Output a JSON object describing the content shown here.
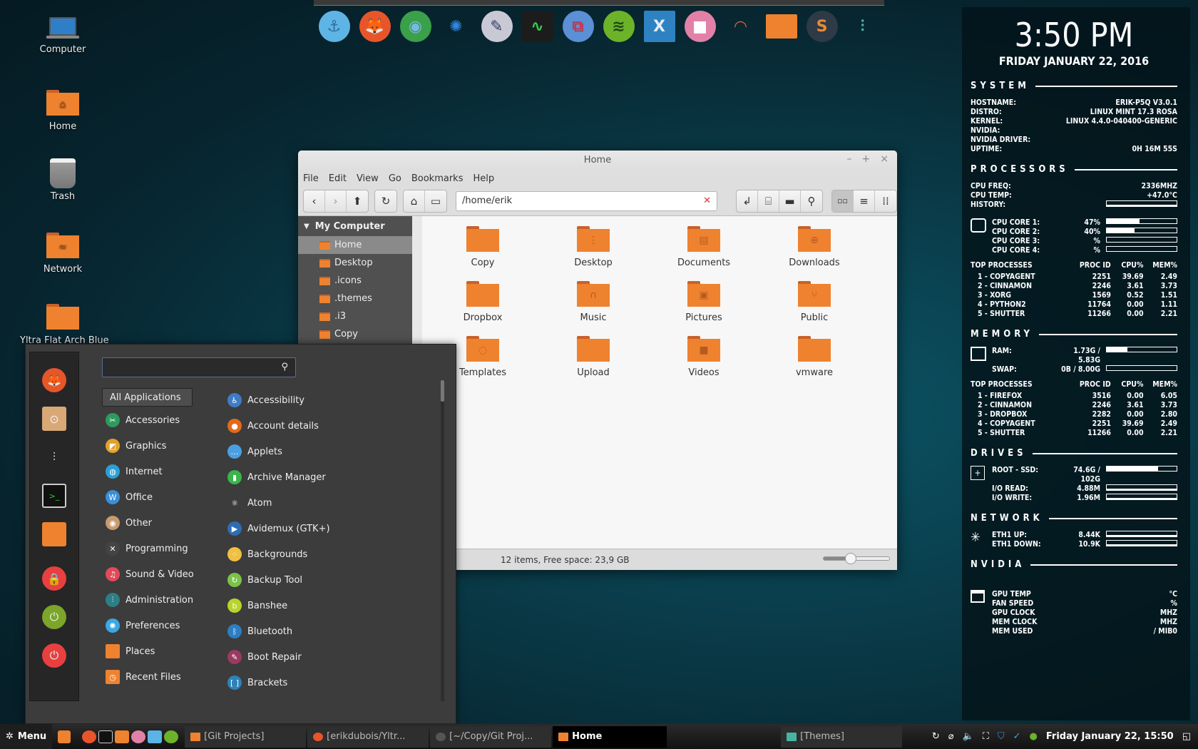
{
  "dock": {
    "items": [
      {
        "name": "anchor",
        "glyph": "⚓",
        "bg": "#5fb4e6",
        "fg": "#2a6e9a"
      },
      {
        "name": "firefox",
        "glyph": "🦊",
        "bg": "#e8552a",
        "fg": "#fff"
      },
      {
        "name": "chrome",
        "glyph": "◉",
        "bg": "#3aa04a",
        "fg": "#7ab8e4"
      },
      {
        "name": "aperture",
        "glyph": "✺",
        "bg": "transparent",
        "fg": "#2f86e0"
      },
      {
        "name": "inkscape",
        "glyph": "✎",
        "bg": "#c9c9d6",
        "fg": "#353a63"
      },
      {
        "name": "system-monitor",
        "glyph": "∿",
        "bg": "#1c1c1c",
        "fg": "#33d04a"
      },
      {
        "name": "remote-desktop",
        "glyph": "⧉",
        "bg": "#5b8fd6",
        "fg": "#c0354d"
      },
      {
        "name": "spotify",
        "glyph": "≋",
        "bg": "#6db32a",
        "fg": "#1e4a10"
      },
      {
        "name": "x-window",
        "glyph": "X",
        "bg": "#2f82c2",
        "fg": "#e6eef6"
      },
      {
        "name": "video-recorder",
        "glyph": "■",
        "bg": "#e281a8",
        "fg": "#fff"
      },
      {
        "name": "disk-usage",
        "glyph": "◠",
        "bg": "transparent",
        "fg": "#e25b3a"
      },
      {
        "name": "folder",
        "glyph": "",
        "bg": "#ef822f",
        "fg": "#ef822f"
      },
      {
        "name": "sublime",
        "glyph": "S",
        "bg": "#2e3a45",
        "fg": "#e98a35"
      },
      {
        "name": "settings-sliders",
        "glyph": "⫶",
        "bg": "transparent",
        "fg": "#46b4a2"
      }
    ]
  },
  "desktop": {
    "icons": [
      {
        "label": "Computer"
      },
      {
        "label": "Home",
        "glyph": "⌂"
      },
      {
        "label": "Trash"
      },
      {
        "label": "Network",
        "glyph": "≈"
      },
      {
        "label": "Yltra Flat Arch Blue"
      }
    ]
  },
  "conky": {
    "time": "3:50 PM",
    "date": "FRIDAY JANUARY 22, 2016",
    "system": {
      "title": "SYSTEM",
      "rows": [
        {
          "k": "HOSTNAME:",
          "v": "ERIK-P5Q  V3.0.1"
        },
        {
          "k": "DISTRO:",
          "v": "LINUX MINT 17.3 ROSA"
        },
        {
          "k": "KERNEL:",
          "v": "LINUX 4.4.0-040400-GENERIC"
        },
        {
          "k": "NVIDIA:",
          "v": ""
        },
        {
          "k": "NVIDIA DRIVER:",
          "v": ""
        },
        {
          "k": "UPTIME:",
          "v": "0H 16M 55S"
        }
      ]
    },
    "processors": {
      "title": "PROCESSORS",
      "freq_label": "CPU FREQ:",
      "freq": "2336MHZ",
      "temp_label": "CPU TEMP:",
      "temp": "+47.0°C",
      "history_label": "HISTORY:",
      "cores": [
        {
          "label": "CPU CORE 1:",
          "value": "47%",
          "pct": 47
        },
        {
          "label": "CPU CORE 2:",
          "value": "40%",
          "pct": 40
        },
        {
          "label": "CPU CORE 3:",
          "value": "%",
          "pct": 0
        },
        {
          "label": "CPU CORE 4:",
          "value": "%",
          "pct": 0
        }
      ],
      "top_header": [
        "TOP PROCESSES",
        "PROC ID",
        "CPU%",
        "MEM%"
      ],
      "top": [
        [
          "1 - COPYAGENT",
          "2251",
          "39.69",
          "2.49"
        ],
        [
          "2 - CINNAMON",
          "2246",
          "3.61",
          "3.73"
        ],
        [
          "3 - XORG",
          "1569",
          "0.52",
          "1.51"
        ],
        [
          "4 - PYTHON2",
          "11764",
          "0.00",
          "1.11"
        ],
        [
          "5 - SHUTTER",
          "11266",
          "0.00",
          "2.21"
        ]
      ]
    },
    "memory": {
      "title": "MEMORY",
      "ram_label": "RAM:",
      "ram": "1.73G / 5.83G",
      "ram_pct": 30,
      "swap_label": "SWAP:",
      "swap": "0B / 8.00G",
      "swap_pct": 0,
      "top_header": [
        "TOP PROCESSES",
        "PROC ID",
        "CPU%",
        "MEM%"
      ],
      "top": [
        [
          "1 - FIREFOX",
          "3516",
          "0.00",
          "6.05"
        ],
        [
          "2 - CINNAMON",
          "2246",
          "3.61",
          "3.73"
        ],
        [
          "3 - DROPBOX",
          "2282",
          "0.00",
          "2.80"
        ],
        [
          "4 - COPYAGENT",
          "2251",
          "39.69",
          "2.49"
        ],
        [
          "5 - SHUTTER",
          "11266",
          "0.00",
          "2.21"
        ]
      ]
    },
    "drives": {
      "title": "DRIVES",
      "root_label": "ROOT - SSD:",
      "root": "74.6G / 102G",
      "root_pct": 73,
      "read_label": "I/O READ:",
      "read": "4.88M",
      "write_label": "I/O WRITE:",
      "write": "1.96M"
    },
    "network": {
      "title": "NETWORK",
      "up_label": "ETH1 UP:",
      "up": "8.44K",
      "down_label": "ETH1 DOWN:",
      "down": "10.9K"
    },
    "nvidia": {
      "title": "NVIDIA",
      "rows": [
        {
          "k": "GPU TEMP",
          "v": "°C"
        },
        {
          "k": "FAN SPEED",
          "v": "%"
        },
        {
          "k": "GPU CLOCK",
          "v": "MHZ"
        },
        {
          "k": "MEM CLOCK",
          "v": "MHZ"
        },
        {
          "k": "MEM USED",
          "v": "/ MIB0"
        }
      ]
    }
  },
  "filemanager": {
    "title": "Home",
    "controls": {
      "minimize": "–",
      "maximize": "+",
      "close": "×"
    },
    "menu": [
      "File",
      "Edit",
      "View",
      "Go",
      "Bookmarks",
      "Help"
    ],
    "path": "/home/erik",
    "clear_glyph": "✕",
    "sidebar": {
      "header": "My Computer",
      "items": [
        {
          "label": "Home",
          "selected": true
        },
        {
          "label": "Desktop"
        },
        {
          "label": ".icons"
        },
        {
          "label": ".themes"
        },
        {
          "label": ".i3"
        },
        {
          "label": "Copy"
        }
      ]
    },
    "items": [
      {
        "label": "Copy",
        "glyph": ""
      },
      {
        "label": "Desktop",
        "glyph": "⋮"
      },
      {
        "label": "Documents",
        "glyph": "▤"
      },
      {
        "label": "Downloads",
        "glyph": "⊕"
      },
      {
        "label": "Dropbox",
        "glyph": ""
      },
      {
        "label": "Music",
        "glyph": "∩"
      },
      {
        "label": "Pictures",
        "glyph": "▣"
      },
      {
        "label": "Public",
        "glyph": "⑂"
      },
      {
        "label": "Templates",
        "glyph": "◌"
      },
      {
        "label": "Upload",
        "glyph": ""
      },
      {
        "label": "Videos",
        "glyph": "■"
      },
      {
        "label": "vmware",
        "glyph": ""
      }
    ],
    "status": "12 items, Free space: 23,9 GB",
    "zoom_level_pct": 40
  },
  "appmenu": {
    "search_placeholder": "",
    "all_apps": "All Applications",
    "categories": [
      {
        "label": "Accessories",
        "glyph": "✂",
        "bg": "#2d9a5e"
      },
      {
        "label": "Graphics",
        "glyph": "◩",
        "bg": "#e2a12b"
      },
      {
        "label": "Internet",
        "glyph": "◍",
        "bg": "#2aa0d8"
      },
      {
        "label": "Office",
        "glyph": "W",
        "bg": "#3b8fd8"
      },
      {
        "label": "Other",
        "glyph": "◉",
        "bg": "#c89a6e"
      },
      {
        "label": "Programming",
        "glyph": "✕",
        "bg": "#444"
      },
      {
        "label": "Sound & Video",
        "glyph": "♫",
        "bg": "#e24a5a"
      },
      {
        "label": "Administration",
        "glyph": "⫶",
        "bg": "#2e7e86"
      },
      {
        "label": "Preferences",
        "glyph": "✺",
        "bg": "#3aa8e4"
      },
      {
        "label": "Places",
        "glyph": "",
        "bg": "#ef822f"
      },
      {
        "label": "Recent Files",
        "glyph": "◷",
        "bg": "#ef822f"
      }
    ],
    "apps": [
      {
        "label": "Accessibility",
        "glyph": "♿",
        "bg": "#3f7cc6"
      },
      {
        "label": "Account details",
        "glyph": "●",
        "bg": "#e46a1a"
      },
      {
        "label": "Applets",
        "glyph": "…",
        "bg": "#4b9fe0"
      },
      {
        "label": "Archive Manager",
        "glyph": "▮",
        "bg": "#39b54a"
      },
      {
        "label": "Atom",
        "glyph": "⚛",
        "bg": "#3c3c3c"
      },
      {
        "label": "Avidemux (GTK+)",
        "glyph": "▶",
        "bg": "#2f6db2"
      },
      {
        "label": "Backgrounds",
        "glyph": "⁘",
        "bg": "#f0c040"
      },
      {
        "label": "Backup Tool",
        "glyph": "↻",
        "bg": "#7cc24a"
      },
      {
        "label": "Banshee",
        "glyph": "b",
        "bg": "#b7d42a"
      },
      {
        "label": "Bluetooth",
        "glyph": "ᛒ",
        "bg": "#2c7ec2"
      },
      {
        "label": "Boot Repair",
        "glyph": "✎",
        "bg": "#9a3a62"
      },
      {
        "label": "Brackets",
        "glyph": "[ ]",
        "bg": "#2d83b8"
      }
    ],
    "favorites": [
      {
        "name": "firefox",
        "glyph": "🦊",
        "bg": "#e8552a"
      },
      {
        "name": "software-manager",
        "glyph": "⊙",
        "bg": "#d9a877"
      },
      {
        "name": "settings",
        "glyph": "⫶",
        "bg": "transparent"
      },
      {
        "name": "terminal",
        "glyph": ">_",
        "bg": "#111"
      },
      {
        "name": "files",
        "glyph": "",
        "bg": "#ef822f"
      },
      {
        "name": "lock-screen",
        "glyph": "🔒",
        "bg": "#e84040"
      },
      {
        "name": "logout",
        "glyph": "⏻",
        "bg": "#7ca52a"
      },
      {
        "name": "shutdown",
        "glyph": "⏻",
        "bg": "#e84040"
      }
    ]
  },
  "taskbar": {
    "menu_label": "Menu",
    "windows": [
      {
        "label": "[Git Projects]",
        "icon": "folder",
        "active": false
      },
      {
        "label": "[erikdubois/Yltr...",
        "icon": "firefox",
        "active": false
      },
      {
        "label": "[~/Copy/Git Proj...",
        "icon": "sublime",
        "active": false
      },
      {
        "label": "Home",
        "icon": "folder",
        "active": true
      },
      {
        "label": "[Themes]",
        "icon": "settings",
        "active": false
      }
    ],
    "clock": "Friday January 22, 15:50"
  }
}
